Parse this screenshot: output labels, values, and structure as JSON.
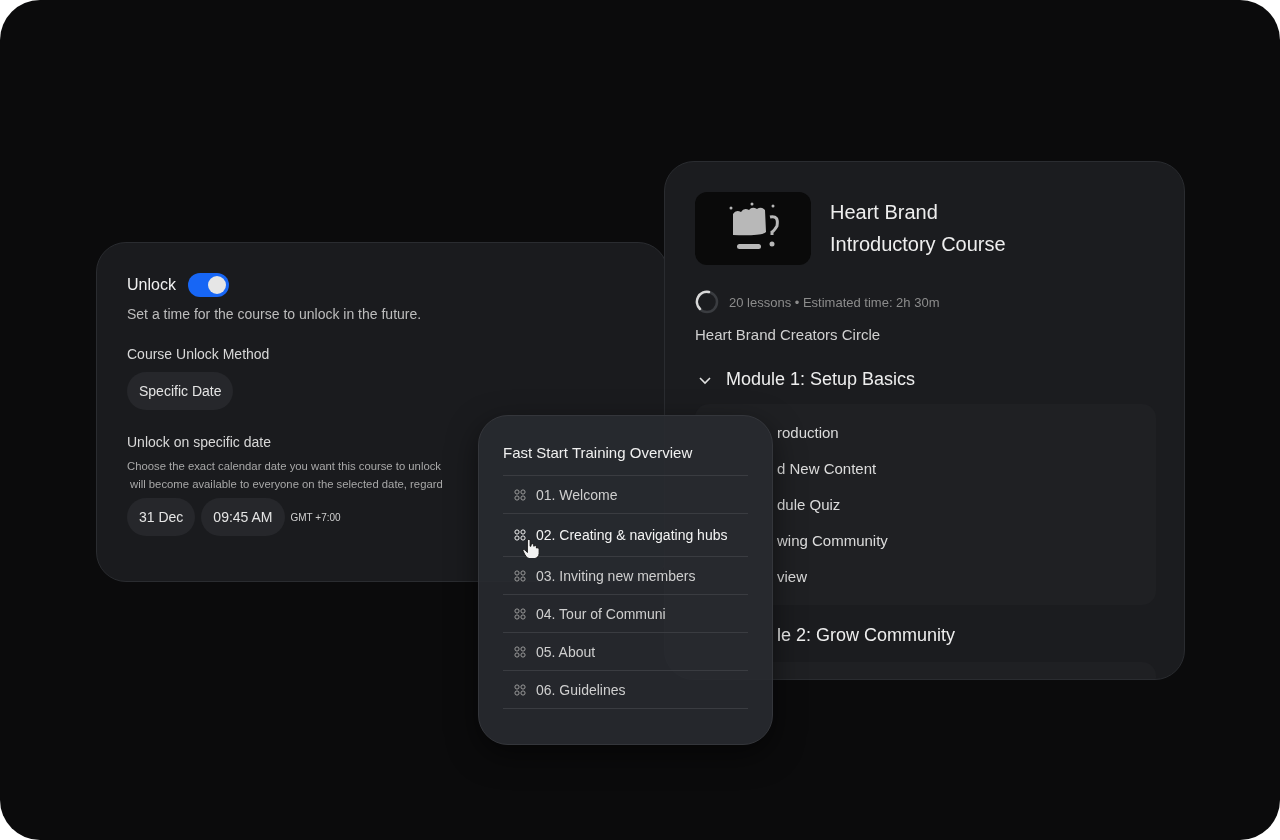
{
  "unlock_card": {
    "title": "Unlock",
    "on": true,
    "description": "Set a time for the course to unlock in the future.",
    "method_label": "Course Unlock Method",
    "method": "Specific Date",
    "date_label": "Unlock on specific date",
    "date_help": [
      "Choose the exact calendar date you want this course to unlock",
      "will become available to everyone on the selected date, regard"
    ],
    "date": "31 Dec",
    "time": "09:45 AM",
    "timezone": "GMT +7:00"
  },
  "course_card": {
    "title": [
      "Heart Brand",
      "Introductory Course"
    ],
    "meta": "20 lessons • Estimated time: 2h 30m",
    "community": "Heart Brand Creators Circle",
    "modules": [
      {
        "title": "Module 1: Setup Basics",
        "expanded": true,
        "partly_hidden": false,
        "lessons": [
          "roduction",
          "d New Content",
          "dule Quiz",
          "wing Community",
          "view"
        ]
      },
      {
        "title": "le 2: Grow Community",
        "expanded": true,
        "partly_hidden": true
      }
    ]
  },
  "overview": {
    "title": "Fast Start Training Overview",
    "items": [
      {
        "label": "01. Welcome",
        "selected": false
      },
      {
        "label": "02. Creating & navigating hubs",
        "selected": true
      },
      {
        "label": "03. Inviting new members",
        "selected": false
      },
      {
        "label": "04. Tour of Communi",
        "selected": false
      },
      {
        "label": "05. About",
        "selected": false
      },
      {
        "label": "06. Guidelines",
        "selected": false
      }
    ]
  }
}
